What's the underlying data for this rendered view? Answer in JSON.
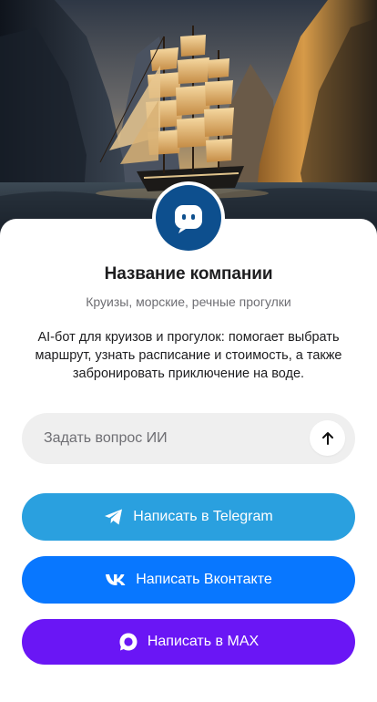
{
  "company": {
    "name": "Название компании",
    "category": "Круизы, морские, речные прогулки",
    "description": "AI-бот для круизов и прогулок: помогает выбрать маршрут, узнать расписание и стоимость, а также забронировать приключение на воде."
  },
  "ask": {
    "placeholder": "Задать вопрос ИИ",
    "value": ""
  },
  "buttons": [
    {
      "label": "Написать в Telegram",
      "icon": "telegram-icon",
      "color": "#2aa0df"
    },
    {
      "label": "Написать Вконтакте",
      "icon": "vk-icon",
      "color": "#0877ff"
    },
    {
      "label": "Написать в MAX",
      "icon": "max-icon",
      "color": "#6a16f5"
    }
  ],
  "avatar": {
    "icon": "chat-bot-icon",
    "color": "#0d4f8e"
  }
}
